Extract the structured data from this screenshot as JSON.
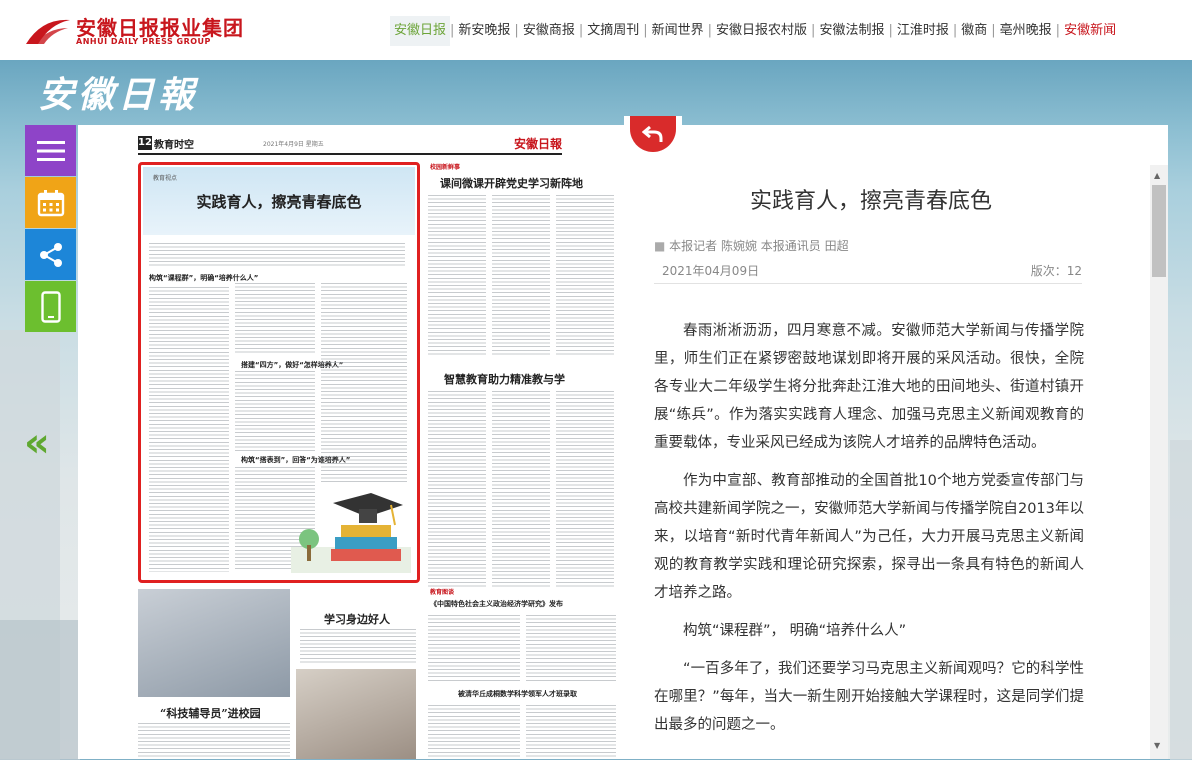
{
  "brand": {
    "group_name": "安徽日报报业集团",
    "group_name_en": "ANHUI DAILY PRESS GROUP",
    "masthead": "安徽日報"
  },
  "nav": {
    "items": [
      {
        "label": "安徽日报",
        "active": true
      },
      {
        "label": "新安晚报"
      },
      {
        "label": "安徽商报"
      },
      {
        "label": "文摘周刊"
      },
      {
        "label": "新闻世界"
      },
      {
        "label": "安徽日报农村版"
      },
      {
        "label": "安徽法制报"
      },
      {
        "label": "江淮时报"
      },
      {
        "label": "徽商"
      },
      {
        "label": "亳州晚报"
      },
      {
        "label": "安徽新闻",
        "highlight": true
      }
    ],
    "colors": {
      "active": "#6ca438",
      "highlight": "#c8161d"
    }
  },
  "sidebar": {
    "buttons": [
      {
        "icon": "menu-icon",
        "color": "#8e44c8"
      },
      {
        "icon": "calendar-icon",
        "color": "#f0a417"
      },
      {
        "icon": "share-icon",
        "color": "#1d86d8"
      },
      {
        "icon": "mobile-icon",
        "color": "#6cbf2f"
      }
    ],
    "prev_page_glyph": "«"
  },
  "paper": {
    "page_number": "12",
    "section": "教育时空",
    "date_line": "2021年4月9日  星期五",
    "masthead": "安徽日報",
    "main_article_kicker": "教育视点",
    "main_article_title": "实践育人，擦亮青春底色",
    "subheads": [
      "构筑“课程群”，明确“培养什么人”",
      "搭建“四方”，做好“怎样培养人”",
      "构筑“搭表到”，回答“为谁培养人”"
    ],
    "column_kicker": "校园新鲜事",
    "column_headline_1": "课间微课开辟党史学习新阵地",
    "column_headline_2": "智慧教育助力精准教与学",
    "column_headline_3": "学习身边好人",
    "column_headline_4": "“科技辅导员”进校园",
    "column_headline_5": "《中国特色社会主义政治经济学研究》发布",
    "column_headline_6": "被清华丘成桐数学科学领军人才班录取"
  },
  "reader": {
    "title": "实践育人，擦亮青春底色",
    "byline": "本报记者 陈婉婉 本报通讯员 田超",
    "date": "2021年04月09日",
    "page_label": "版次：12",
    "paragraphs": [
      "春雨淅淅沥沥，四月寒意不减。安徽师范大学新闻与传播学院里，师生们正在紧锣密鼓地谋划即将开展的采风活动。很快，全院各专业大二年级学生将分批奔赴江淮大地的田间地头、街道村镇开展“练兵”。作为落实实践育人理念、加强马克思主义新闻观教育的重要载体，专业采风已经成为该院人才培养的品牌特色活动。",
      "作为中宣部、教育部推动的全国首批10个地方党委宣传部门与高校共建新闻学院之一，安徽师范大学新闻与传播学院自2013年以来，以培育“新时代青年新闻人”为己任，大力开展马克思主义新闻观的教育教学实践和理论研究探索，探寻出一条具有特色的新闻人才培养之路。",
      "构筑“课程群”， 明确“培养什么人”",
      "“一百多年了，我们还要学习马克思主义新闻观吗？它的科学性在哪里？”每年，当大一新生刚开始接触大学课程时，这是同学们提出最多的问题之一。"
    ]
  }
}
